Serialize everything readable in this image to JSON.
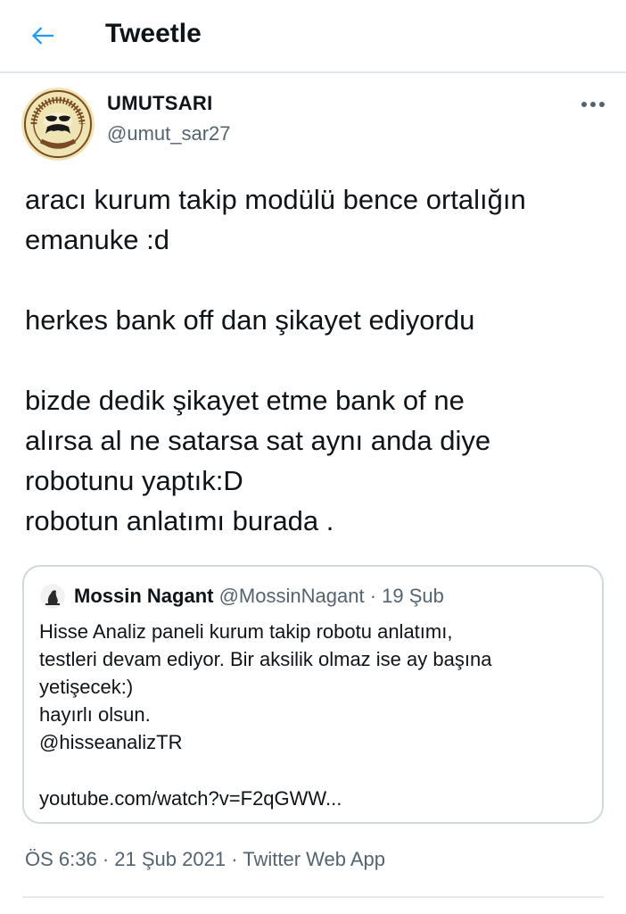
{
  "header": {
    "title": "Tweetle",
    "back_icon": "arrow-left-icon",
    "accent_color": "#1d9bf0"
  },
  "tweet": {
    "author_name": "UMUTSARI",
    "author_handle": "@umut_sar27",
    "more_icon": "more-horizontal-icon",
    "text": "aracı kurum takip modülü bence ortalığın\nemanuke :d\n\nherkes bank off dan şikayet ediyordu\n\nbizde dedik şikayet etme bank of ne\nalırsa al ne satarsa sat aynı anda diye\nrobotunu yaptık:D\nrobotun anlatımı burada .",
    "time": "ÖS 6:36",
    "date": "21 Şub 2021",
    "source": "Twitter Web App",
    "separator": "·"
  },
  "quoted": {
    "author_name": "Mossin Nagant",
    "author_handle": "@MossinNagant",
    "date": "19 Şub",
    "separator": "·",
    "text": "Hisse Analiz paneli kurum takip robotu anlatımı,\ntestleri devam ediyor. Bir aksilik olmaz ise ay başına\nyetişecek:)\nhayırlı olsun.\n@hisseanalizTR",
    "link": "youtube.com/watch?v=F2qGWW..."
  },
  "avatar_seal_text": {
    "top_arc": "E BİZ BOŞUNA MI BEKLEDİK",
    "bottom": "BABAYİĞİT"
  }
}
